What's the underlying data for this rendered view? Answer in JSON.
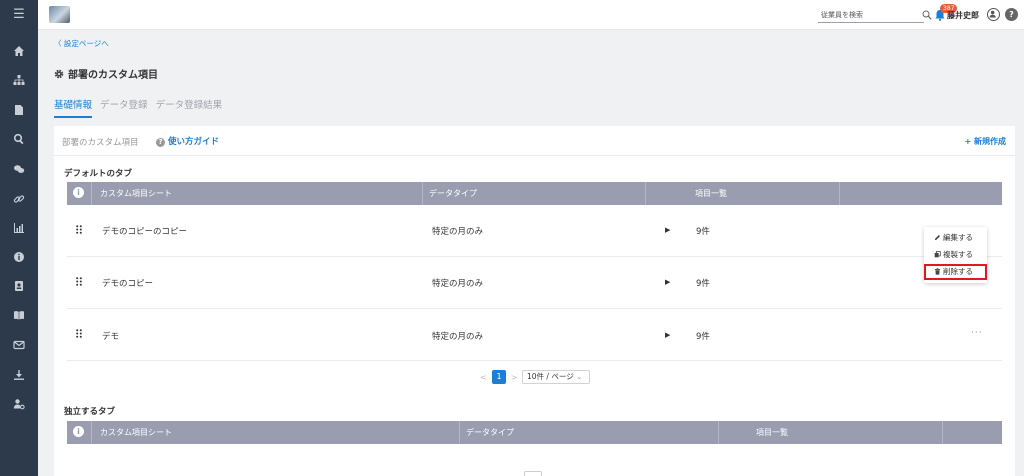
{
  "sidebar": {
    "items": [
      {
        "icon": "menu-icon"
      },
      {
        "icon": "home-icon"
      },
      {
        "icon": "org-chart-icon"
      },
      {
        "icon": "document-icon"
      },
      {
        "icon": "search-icon"
      },
      {
        "icon": "chat-icon"
      },
      {
        "icon": "link-icon"
      },
      {
        "icon": "chart-icon"
      },
      {
        "icon": "info-icon"
      },
      {
        "icon": "contact-card-icon"
      },
      {
        "icon": "book-icon"
      },
      {
        "icon": "mail-icon"
      },
      {
        "icon": "download-icon"
      },
      {
        "icon": "user-settings-icon"
      }
    ]
  },
  "topbar": {
    "search_placeholder": "従業員を検索",
    "notification_count": "387",
    "user_name": "藤井史郎",
    "help_label": "?"
  },
  "breadcrumb": {
    "back_label": "〈 設定ページへ"
  },
  "page": {
    "title": "部署のカスタム項目"
  },
  "tabs": [
    {
      "label": "基礎情報",
      "active": true
    },
    {
      "label": "データ登録",
      "active": false
    },
    {
      "label": "データ登録結果",
      "active": false
    }
  ],
  "card": {
    "title": "部署のカスタム項目",
    "guide_label": "使い方ガイド",
    "new_button_label": "+ 新規作成"
  },
  "default_section": {
    "title": "デフォルトのタブ",
    "columns": [
      "カスタム項目シート",
      "データタイプ",
      "項目一覧"
    ],
    "rows": [
      {
        "name": "デモのコピーのコピー",
        "data_type": "特定の月のみ",
        "count": "9件"
      },
      {
        "name": "デモのコピー",
        "data_type": "特定の月のみ",
        "count": "9件"
      },
      {
        "name": "デモ",
        "data_type": "特定の月のみ",
        "count": "9件",
        "more": "···"
      }
    ]
  },
  "pagination": {
    "current_page": "1",
    "page_size_label": "10件 / ページ"
  },
  "independent_section": {
    "title": "独立するタブ",
    "columns": [
      "カスタム項目シート",
      "データタイプ",
      "項目一覧"
    ]
  },
  "context_menu": {
    "items": [
      {
        "label": "編集する",
        "icon": "pencil-icon"
      },
      {
        "label": "複製する",
        "icon": "copy-icon"
      },
      {
        "label": "削除する",
        "icon": "trash-icon",
        "highlighted": true
      }
    ]
  },
  "colors": {
    "accent": "#1a7fd6",
    "sidebar_bg": "#2d3a4b",
    "table_header": "#9a9db0",
    "highlight_border": "#e0191e",
    "badge": "#e85a38"
  }
}
